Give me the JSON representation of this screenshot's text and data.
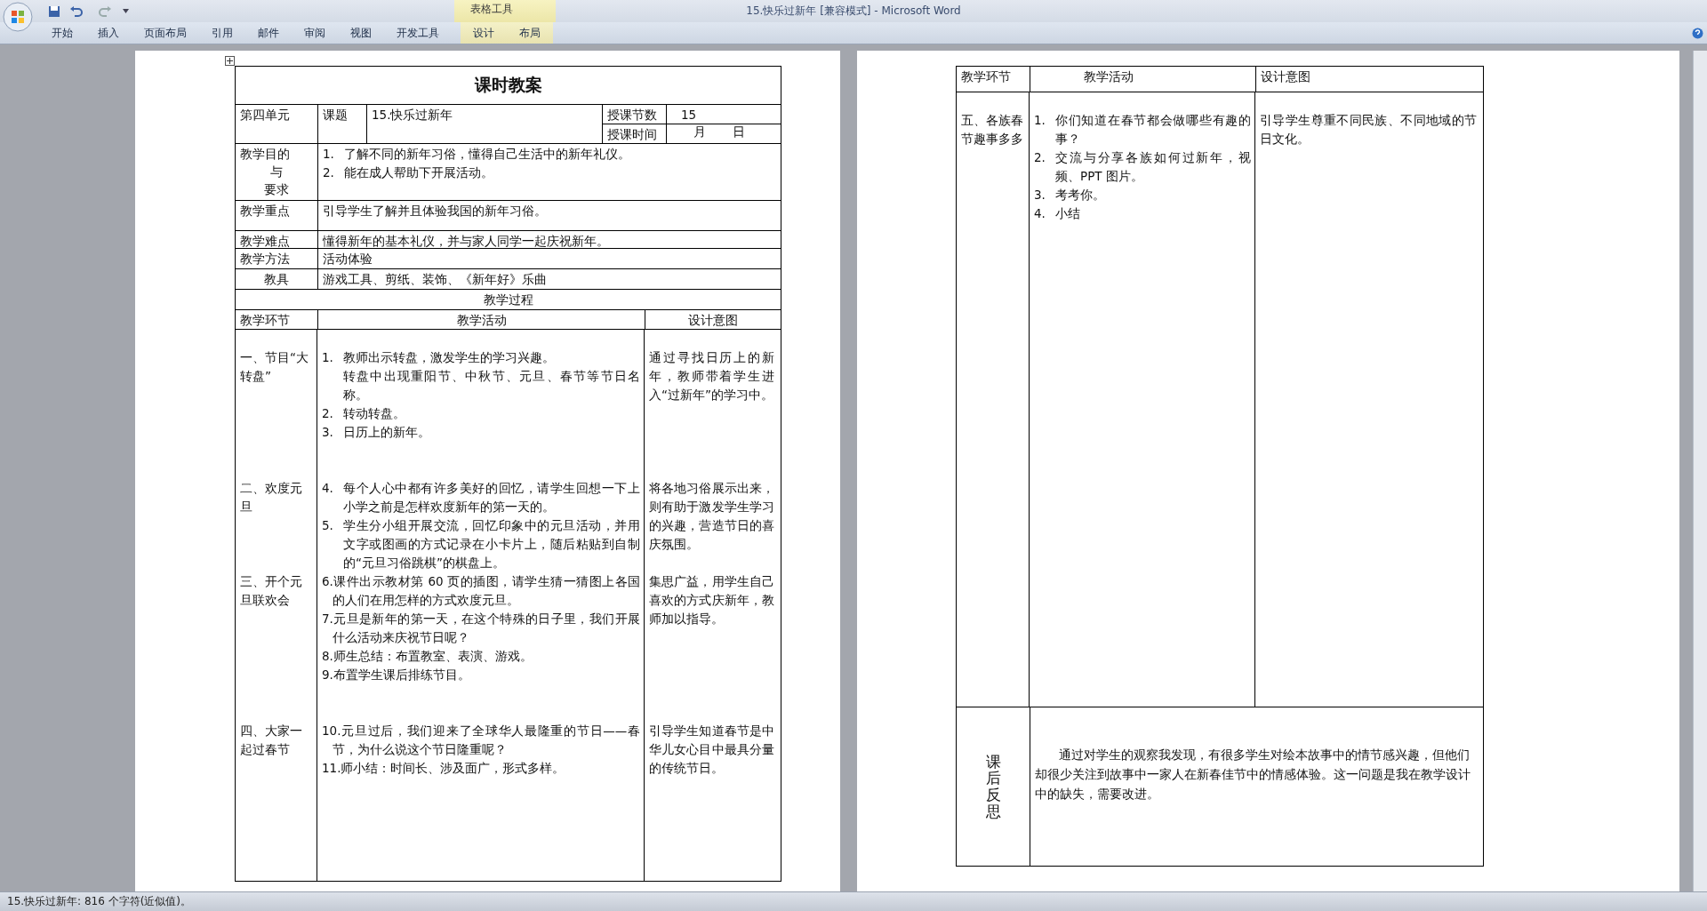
{
  "app": {
    "title": "15.快乐过新年 [兼容模式] - Microsoft Word",
    "context_group": "表格工具",
    "tabs": [
      {
        "label": "开始",
        "contextual": false
      },
      {
        "label": "插入",
        "contextual": false
      },
      {
        "label": "页面布局",
        "contextual": false
      },
      {
        "label": "引用",
        "contextual": false
      },
      {
        "label": "邮件",
        "contextual": false
      },
      {
        "label": "审阅",
        "contextual": false
      },
      {
        "label": "视图",
        "contextual": false
      },
      {
        "label": "开发工具",
        "contextual": false
      },
      {
        "label": "设计",
        "contextual": true
      },
      {
        "label": "布局",
        "contextual": true
      }
    ]
  },
  "page1": {
    "title": "课时教案",
    "unit": "第四单元",
    "topic_label": "课题",
    "topic": "15.快乐过新年",
    "periods_label": "授课节数",
    "periods": "15",
    "time_label": "授课时间",
    "month": "月",
    "day": "日",
    "goals": {
      "label_lines": [
        "教学目的",
        "与",
        "要求"
      ],
      "items": [
        {
          "num": "1.",
          "text": "了解不同的新年习俗，懂得自己生活中的新年礼仪。"
        },
        {
          "num": "2.",
          "text": "能在成人帮助下开展活动。"
        }
      ]
    },
    "info_rows": [
      {
        "label": "教学重点",
        "value": "引导学生了解并且体验我国的新年习俗。",
        "kind": "plain"
      },
      {
        "label": "教学难点",
        "value": "懂得新年的基本礼仪，并与家人同学一起庆祝新年。",
        "kind": "plain"
      },
      {
        "label": "教学方法",
        "value": "活动体验",
        "kind": "plain"
      },
      {
        "label": "教具",
        "value": "游戏工具、剪纸、装饰、《新年好》乐曲",
        "kind": "centered"
      }
    ],
    "process_title": "教学过程",
    "columns": [
      "教学环节",
      "教学活动",
      "设计意图"
    ],
    "stages": [
      {
        "label": "一、节目“大转盘”",
        "items": [
          {
            "kind": "numbered",
            "num": "1.",
            "text": "教师出示转盘，激发学生的学习兴趣。"
          },
          {
            "kind": "continuation",
            "text": "转盘中出现重阳节、中秋节、元旦、春节等节日名称。"
          },
          {
            "kind": "numbered",
            "num": "2.",
            "text": "转动转盘。"
          },
          {
            "kind": "numbered",
            "num": "3.",
            "text": "日历上的新年。"
          }
        ],
        "intent": "通过寻找日历上的新年，教师带着学生进入“过新年”的学习中。"
      },
      {
        "label": "二、欢度元旦",
        "items": [
          {
            "kind": "numbered",
            "num": "4.",
            "text": "每个人心中都有许多美好的回忆，请学生回想一下上小学之前是怎样欢度新年的第一天的。"
          },
          {
            "kind": "numbered",
            "num": "5.",
            "text": "学生分小组开展交流，回忆印象中的元旦活动，并用文字或图画的方式记录在小卡片上，随后粘贴到自制的“元旦习俗跳棋”的棋盘上。"
          }
        ],
        "intent": "将各地习俗展示出来，则有助于激发学生学习的兴趣，营造节日的喜庆氛围。"
      },
      {
        "label": "三、开个元旦联欢会",
        "items": [
          {
            "kind": "inline",
            "text": "6.课件出示教材第 60 页的插图，请学生猜一猜图上各国的人们在用怎样的方式欢度元旦。"
          },
          {
            "kind": "inline",
            "text": "7.元旦是新年的第一天，在这个特殊的日子里，我们开展什么活动来庆祝节日呢？"
          },
          {
            "kind": "inline",
            "text": "8.师生总结：布置教室、表演、游戏。"
          },
          {
            "kind": "inline",
            "text": "9.布置学生课后排练节目。"
          }
        ],
        "intent": "集思广益，用学生自己喜欢的方式庆新年，教师加以指导。"
      },
      {
        "label": "四、大家一起过春节",
        "items": [
          {
            "kind": "inline",
            "text": "10.元旦过后，我们迎来了全球华人最隆重的节日——春节，为什么说这个节日隆重呢？"
          },
          {
            "kind": "inline",
            "text": "11.师小结：时间长、涉及面广，形式多样。"
          }
        ],
        "intent": "引导学生知道春节是中华儿女心目中最具分量的传统节日。"
      }
    ]
  },
  "page2": {
    "columns": [
      "教学环节",
      "教学活动",
      "设计意图"
    ],
    "stage": {
      "label": "五、各族春节趣事多多",
      "items": [
        {
          "kind": "numbered",
          "num": "1.",
          "text": "你们知道在春节都会做哪些有趣的事？"
        },
        {
          "kind": "numbered",
          "num": "2.",
          "text": "交流与分享各族如何过新年，视频、PPT 图片。"
        },
        {
          "kind": "numbered",
          "num": "3.",
          "text": "考考你。"
        },
        {
          "kind": "numbered",
          "num": "4.",
          "text": "小结"
        }
      ],
      "intent": "引导学生尊重不同民族、不同地域的节日文化。"
    },
    "reflection": {
      "label": "课后反思",
      "text": "通过对学生的观察我发现，有很多学生对绘本故事中的情节感兴趣，但他们却很少关注到故事中一家人在新春佳节中的情感体验。这一问题是我在教学设计中的缺失，需要改进。"
    }
  },
  "status_bar": "15.快乐过新年: 816 个字符(近似值)。"
}
